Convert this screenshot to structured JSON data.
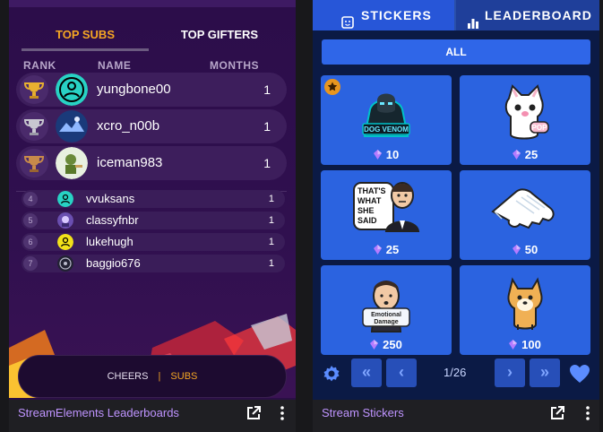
{
  "leaderboard": {
    "tabs": [
      "TOP SUBS",
      "TOP GIFTERS"
    ],
    "headers": {
      "rank": "RANK",
      "name": "NAME",
      "months": "MONTHS"
    },
    "top": [
      {
        "name": "yungbone00",
        "months": "1"
      },
      {
        "name": "xcro_n00b",
        "months": "1"
      },
      {
        "name": "iceman983",
        "months": "1"
      }
    ],
    "rows": [
      {
        "rank": "4",
        "name": "vvuksans",
        "months": "1"
      },
      {
        "rank": "5",
        "name": "classyfnbr",
        "months": "1"
      },
      {
        "rank": "6",
        "name": "lukehugh",
        "months": "1"
      },
      {
        "rank": "7",
        "name": "baggio676",
        "months": "1"
      }
    ],
    "toggle": {
      "cheers": "CHEERS",
      "sep": "|",
      "subs": "SUBS"
    },
    "footer": "StreamElements Leaderboards"
  },
  "stickers": {
    "tabs": [
      "STICKERS",
      "LEADERBOARD"
    ],
    "filter": "ALL",
    "cards": [
      {
        "price": "10",
        "featured": true
      },
      {
        "price": "25",
        "featured": false
      },
      {
        "price": "25",
        "featured": false
      },
      {
        "price": "50",
        "featured": false
      },
      {
        "price": "250",
        "featured": false
      },
      {
        "price": "100",
        "featured": false
      }
    ],
    "pagination": "1/26",
    "footer": "Stream Stickers",
    "sticker_texts": {
      "gamer": "DOG VENOM",
      "cat": "POP",
      "elon": [
        "THAT'S",
        "WHAT",
        "SHE",
        "SAID"
      ],
      "emotional": [
        "Emotional",
        "Damage"
      ]
    }
  },
  "colors": {
    "accent_orange": "#f5a623",
    "footer_link": "#bf94ff",
    "sticker_blue": "#2b63e0"
  }
}
